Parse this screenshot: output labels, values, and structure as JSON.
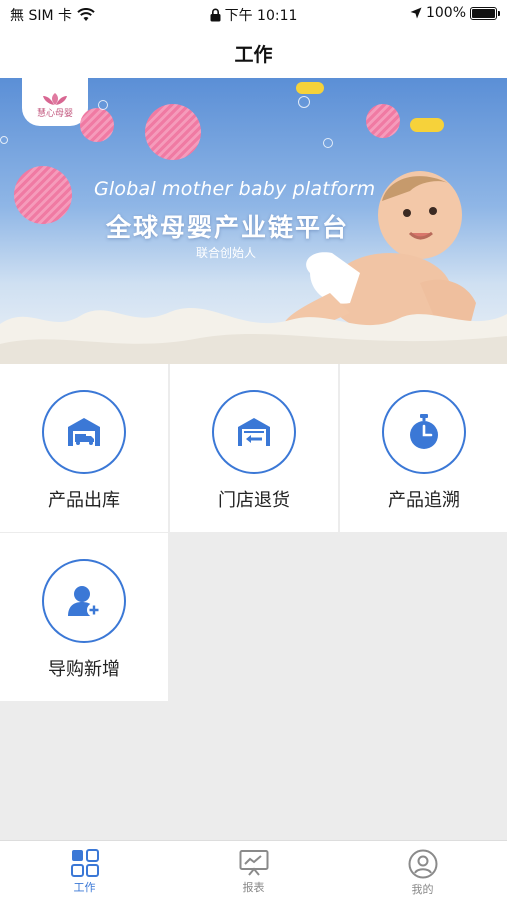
{
  "status_bar": {
    "carrier": "無 SIM 卡",
    "time": "下午 10:11",
    "battery": "100%"
  },
  "nav": {
    "title": "工作"
  },
  "banner": {
    "logo_text": "慧心母婴",
    "headline_en": "Global mother baby platform",
    "headline_cn": "全球母婴产业链平台",
    "subtitle": "联合创始人"
  },
  "menu": {
    "items": [
      {
        "label": "产品出库",
        "icon": "warehouse-truck-icon"
      },
      {
        "label": "门店退货",
        "icon": "store-return-icon"
      },
      {
        "label": "产品追溯",
        "icon": "stopwatch-icon"
      },
      {
        "label": "导购新增",
        "icon": "add-user-icon"
      }
    ]
  },
  "tab_bar": {
    "tabs": [
      {
        "label": "工作",
        "icon": "grid-icon",
        "active": true
      },
      {
        "label": "报表",
        "icon": "chart-monitor-icon",
        "active": false
      },
      {
        "label": "我的",
        "icon": "user-circle-icon",
        "active": false
      }
    ]
  },
  "colors": {
    "accent": "#3b78d6",
    "balloon": "#f07aa3"
  }
}
